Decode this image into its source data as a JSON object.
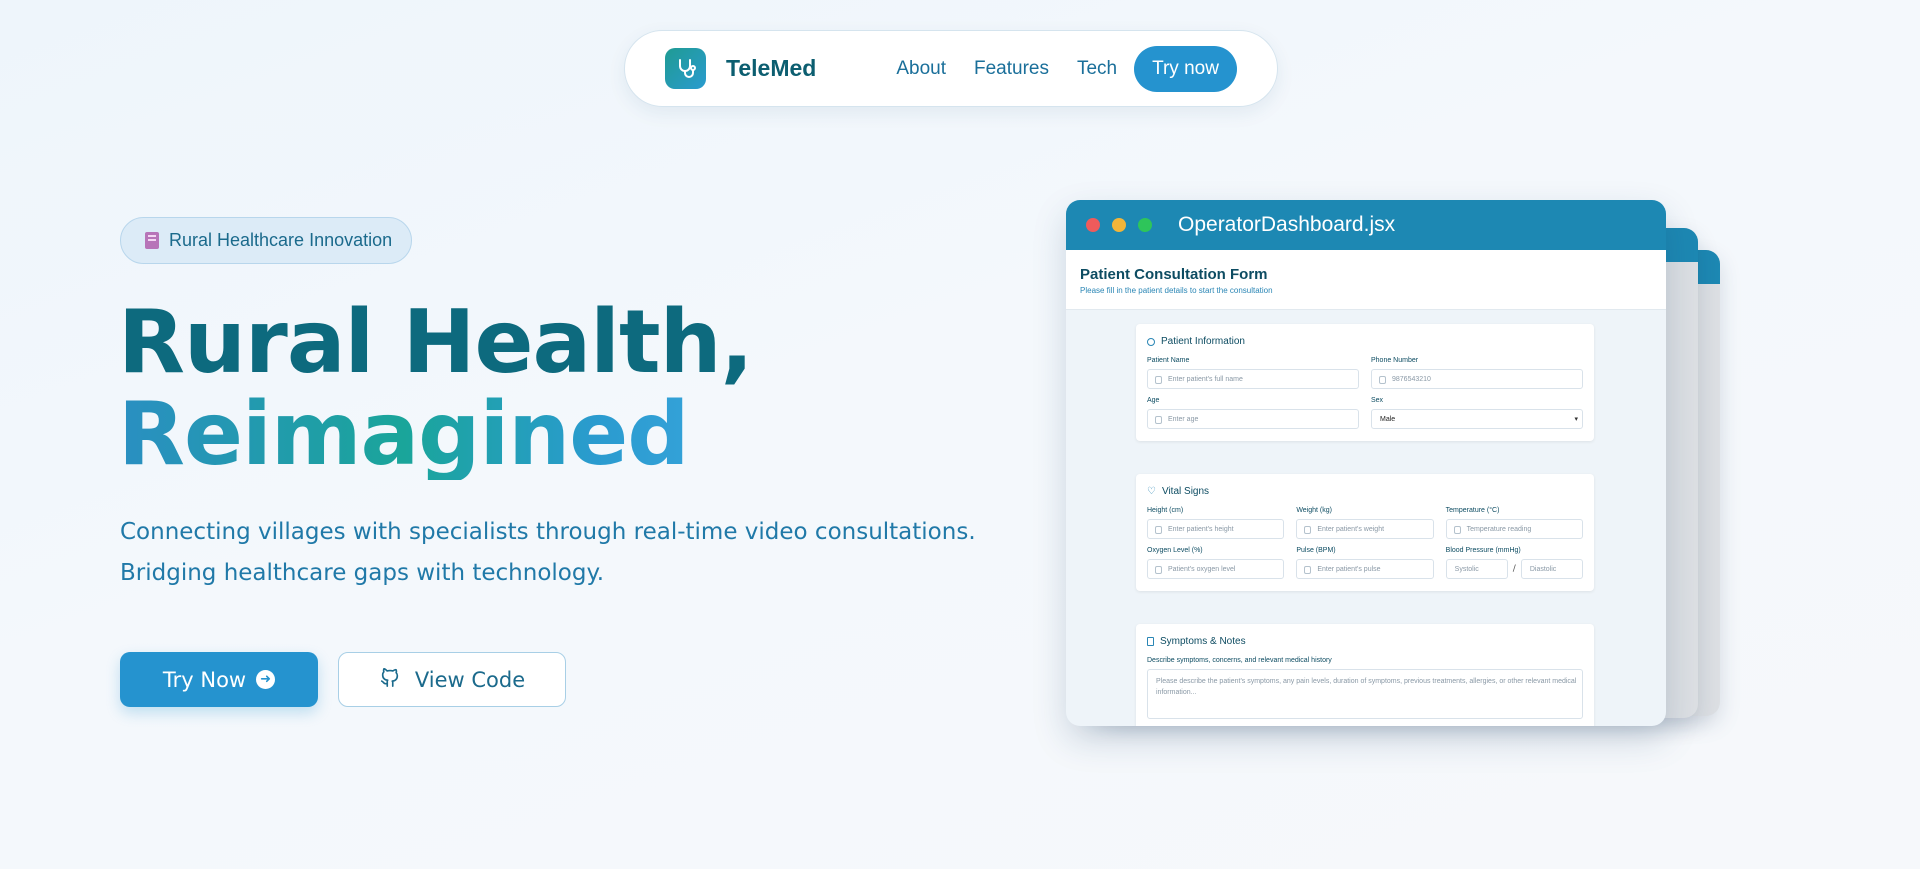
{
  "nav": {
    "brand": "TeleMed",
    "links": [
      "About",
      "Features",
      "Tech"
    ],
    "cta": "Try now"
  },
  "hero": {
    "badge": "Rural Healthcare Innovation",
    "title_line1": "Rural Health,",
    "title_line2": "Reimagined",
    "subtitle_line1": "Connecting villages with specialists through real-time video consultations.",
    "subtitle_line2": "Bridging healthcare gaps with technology.",
    "primary_button": "Try Now",
    "secondary_button": "View Code"
  },
  "mockup": {
    "window_title": "OperatorDashboard.jsx",
    "form_title": "Patient Consultation Form",
    "form_subtitle": "Please fill in the patient details to start the consultation",
    "patient_info": {
      "title": "Patient Information",
      "name_label": "Patient Name",
      "name_placeholder": "Enter patient's full name",
      "phone_label": "Phone Number",
      "phone_placeholder": "9876543210",
      "age_label": "Age",
      "age_placeholder": "Enter age",
      "sex_label": "Sex",
      "sex_value": "Male"
    },
    "vitals": {
      "title": "Vital Signs",
      "height_label": "Height (cm)",
      "height_placeholder": "Enter patient's height",
      "weight_label": "Weight (kg)",
      "weight_placeholder": "Enter patient's weight",
      "temp_label": "Temperature (°C)",
      "temp_placeholder": "Temperature reading",
      "oxygen_label": "Oxygen Level (%)",
      "oxygen_placeholder": "Patient's oxygen level",
      "pulse_label": "Pulse (BPM)",
      "pulse_placeholder": "Enter patient's pulse",
      "bp_label": "Blood Pressure (mmHg)",
      "bp_systolic": "Systolic",
      "bp_diastolic": "Diastolic"
    },
    "symptoms": {
      "title": "Symptoms & Notes",
      "label": "Describe symptoms, concerns, and relevant medical history",
      "placeholder": "Please describe the patient's symptoms, any pain levels, duration of symptoms, previous treatments, allergies, or other relevant medical information..."
    }
  },
  "colors": {
    "primary": "#2593cf",
    "heading": "#0d6a7e",
    "window_bar": "#1d88b3"
  }
}
